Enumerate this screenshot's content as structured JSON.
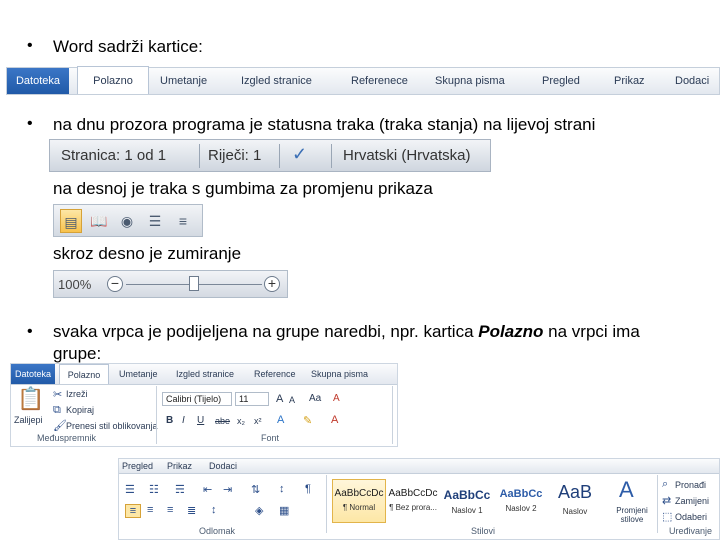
{
  "bullets": {
    "b1": "•",
    "b2": "•",
    "b3": "•"
  },
  "text": {
    "line1": "Word sadrži kartice:",
    "line2": "na dnu prozora programa je statusna traka (traka stanja) na lijevoj strani",
    "line3": "na desnoj je traka s gumbima za promjenu prikaza",
    "line4": "skroz desno je zumiranje",
    "line5_a": "svaka vrpca je podijeljena na grupe naredbi, npr. kartica ",
    "line5_b": "Polazno",
    "line5_c": " na vrpci ima",
    "line6": "grupe:"
  },
  "ribbon_tabs": [
    "Datoteka",
    "Polazno",
    "Umetanje",
    "Izgled stranice",
    "Referenece",
    "Skupna pisma",
    "Pregled",
    "Prikaz",
    "Dodaci"
  ],
  "status_bar": {
    "page": "Stranica: 1 od 1",
    "words": "Riječi: 1",
    "language": "Hrvatski (Hrvatska)"
  },
  "zoom": {
    "percent": "100%",
    "minus": "−",
    "plus": "+",
    "level": 0.5
  },
  "panel1": {
    "tabs": [
      "Datoteka",
      "Polazno",
      "Umetanje",
      "Izgled stranice",
      "Reference",
      "Skupna pisma"
    ],
    "paste": "Zalijepi",
    "cut": "Izreži",
    "copy": "Kopiraj",
    "format_painter": "Prenesi stil oblikovanja",
    "clipboard_group": "Međuspremnik",
    "font_name": "Calibri (Tijelo)",
    "font_size": "11",
    "font_group": "Font",
    "bold": "B",
    "italic": "I",
    "underline": "U",
    "strike": "abe",
    "sub": "x₂",
    "sup": "x²",
    "grow": "A",
    "shrink": "A",
    "case": "Aa",
    "clear": "A"
  },
  "panel2": {
    "tabs": [
      "Pregled",
      "Prikaz",
      "Dodaci"
    ],
    "paragraph_group": "Odlomak",
    "styles_group": "Stilovi",
    "editing_group": "Uređivanje",
    "styles": [
      {
        "sample": "AaBbCcDc",
        "name": "¶ Normal"
      },
      {
        "sample": "AaBbCcDc",
        "name": "¶ Bez prora..."
      },
      {
        "sample": "AaBbCc",
        "name": "Naslov 1"
      },
      {
        "sample": "AaBbCc",
        "name": "Naslov 2"
      },
      {
        "sample": "AaB",
        "name": "Naslov"
      }
    ],
    "change_styles": "Promjeni stilove",
    "find": "Pronađi",
    "replace": "Zamijeni",
    "select": "Odaberi"
  }
}
